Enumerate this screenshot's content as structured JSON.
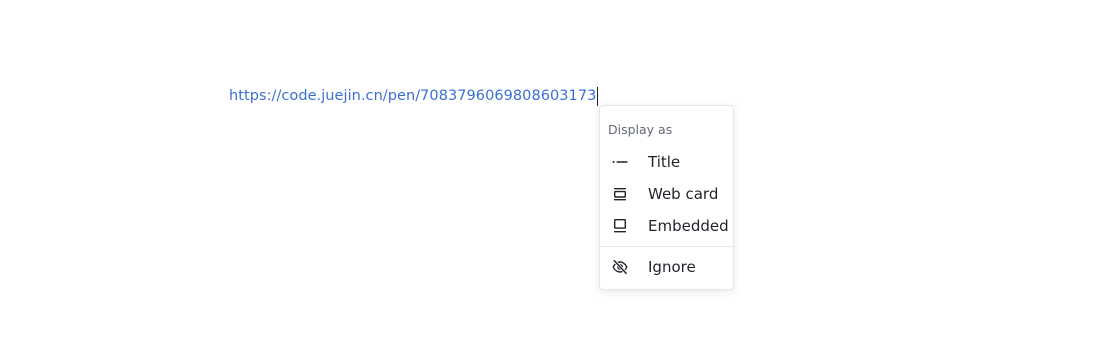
{
  "editor": {
    "url_text": "https://code.juejin.cn/pen/7083796069808603173"
  },
  "menu": {
    "header": "Display as",
    "items": [
      {
        "label": "Title",
        "icon": "title-icon"
      },
      {
        "label": "Web card",
        "icon": "web-card-icon"
      },
      {
        "label": "Embedded",
        "icon": "embedded-icon"
      }
    ],
    "ignore": {
      "label": "Ignore",
      "icon": "eye-off-icon"
    }
  },
  "colors": {
    "link": "#3b6fd6",
    "text": "#1f2329",
    "muted": "#646a73",
    "border": "#e4e6ea"
  }
}
